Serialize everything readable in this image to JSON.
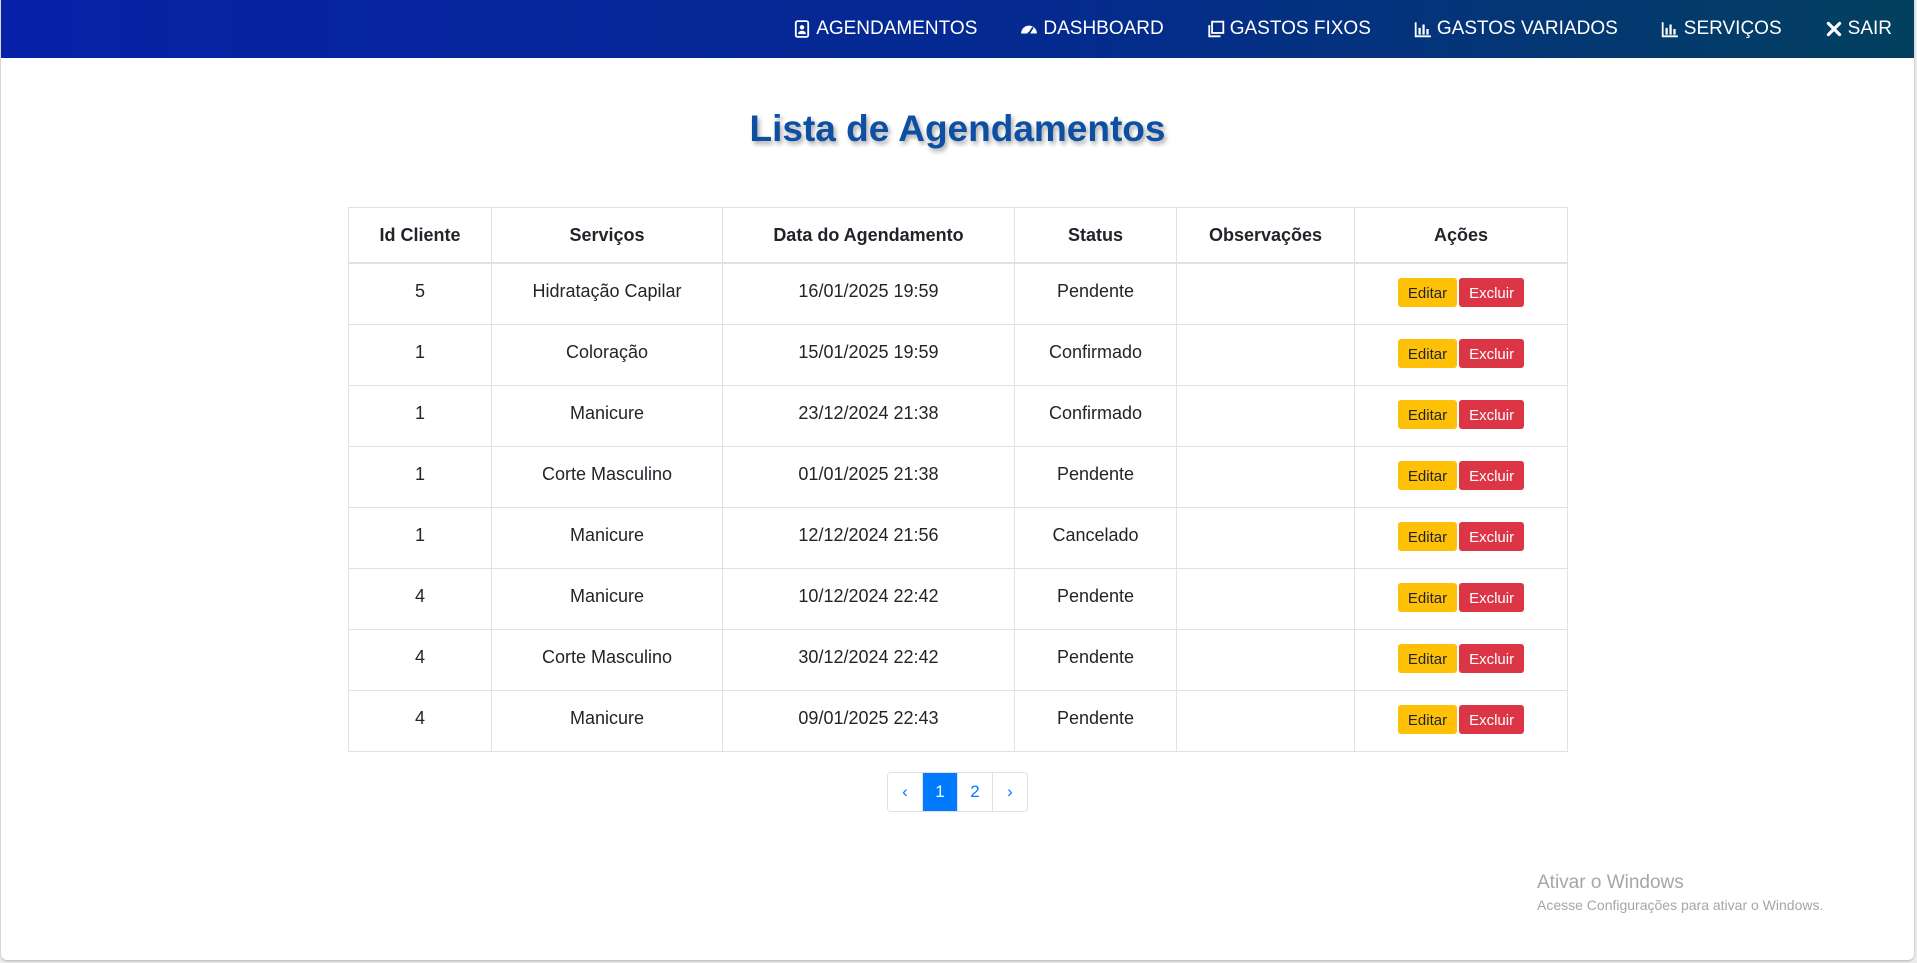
{
  "nav": {
    "items": [
      {
        "label": "AGENDAMENTOS",
        "icon": "address-card-icon"
      },
      {
        "label": "DASHBOARD",
        "icon": "gauge-icon"
      },
      {
        "label": "GASTOS FIXOS",
        "icon": "copy-icon"
      },
      {
        "label": "GASTOS VARIADOS",
        "icon": "bar-chart-icon"
      },
      {
        "label": "SERVIÇOS",
        "icon": "bar-chart-icon"
      },
      {
        "label": "SAIR",
        "icon": "close-icon"
      }
    ]
  },
  "page": {
    "title": "Lista de Agendamentos"
  },
  "table": {
    "headers": [
      "Id Cliente",
      "Serviços",
      "Data do Agendamento",
      "Status",
      "Observações",
      "Ações"
    ],
    "rows": [
      [
        "5",
        "Hidratação Capilar",
        "16/01/2025 19:59",
        "Pendente",
        ""
      ],
      [
        "1",
        "Coloração",
        "15/01/2025 19:59",
        "Confirmado",
        ""
      ],
      [
        "1",
        "Manicure",
        "23/12/2024 21:38",
        "Confirmado",
        ""
      ],
      [
        "1",
        "Corte Masculino",
        "01/01/2025 21:38",
        "Pendente",
        ""
      ],
      [
        "1",
        "Manicure",
        "12/12/2024 21:56",
        "Cancelado",
        ""
      ],
      [
        "4",
        "Manicure",
        "10/12/2024 22:42",
        "Pendente",
        ""
      ],
      [
        "4",
        "Corte Masculino",
        "30/12/2024 22:42",
        "Pendente",
        ""
      ],
      [
        "4",
        "Manicure",
        "09/01/2025 22:43",
        "Pendente",
        ""
      ]
    ],
    "edit_label": "Editar",
    "delete_label": "Excluir"
  },
  "pagination": {
    "prev": "‹",
    "pages": [
      "1",
      "2"
    ],
    "active": "1",
    "next": "›"
  },
  "watermark": {
    "title": "Ativar o Windows",
    "subtitle": "Acesse Configurações para ativar o Windows."
  },
  "colors": {
    "edit_button": "#ffc107",
    "delete_button": "#dc3545",
    "title": "#0d4fa3",
    "page_active": "#007bff"
  }
}
